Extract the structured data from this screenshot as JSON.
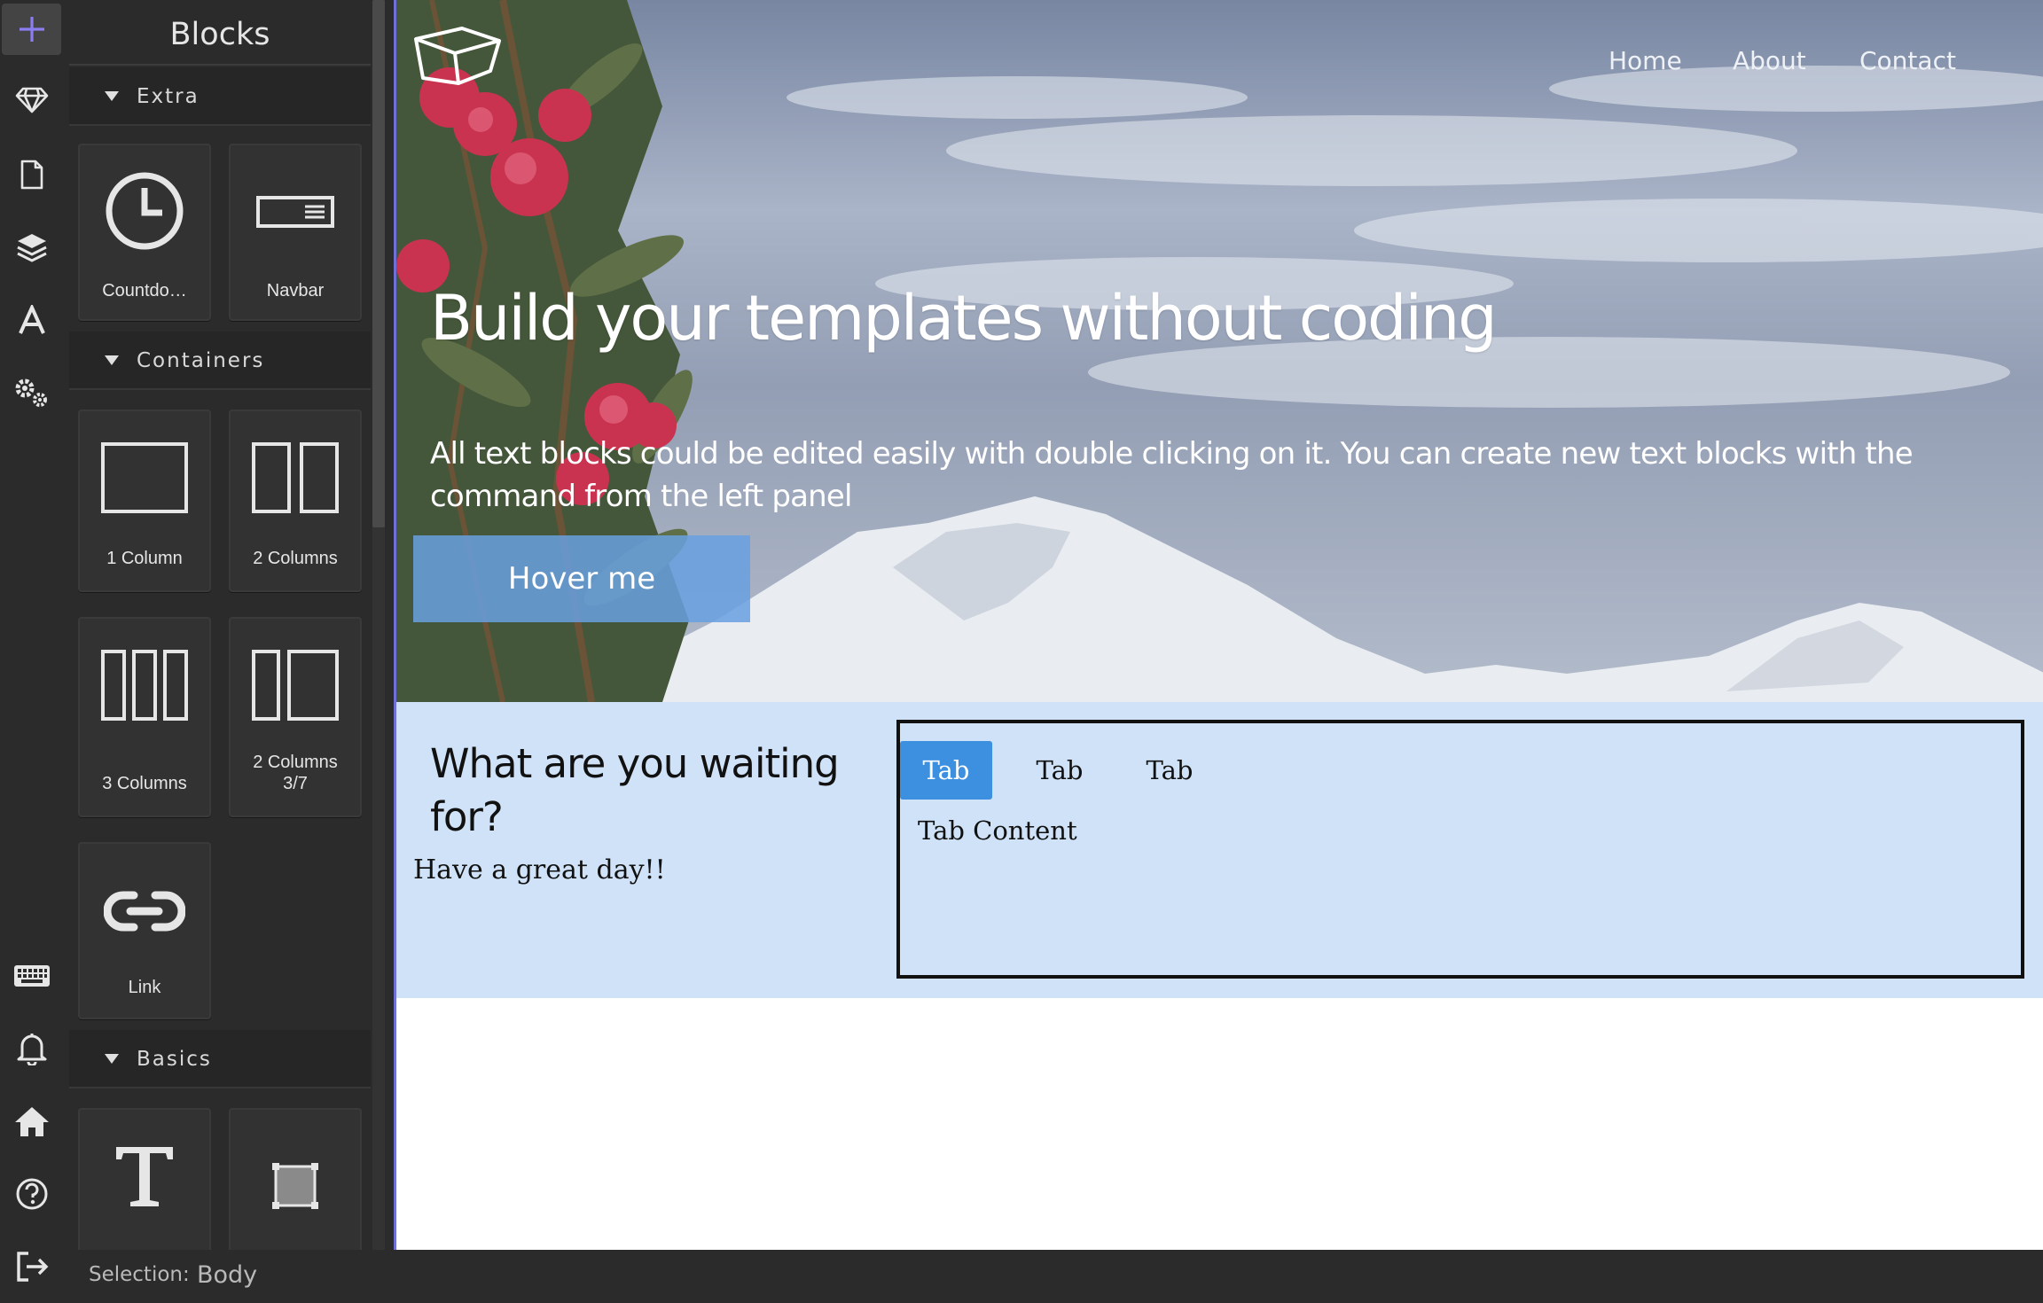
{
  "rail": {
    "top_icons": [
      "plus-icon",
      "diamond-icon",
      "page-icon",
      "layers-icon",
      "typography-icon",
      "settings-icon"
    ],
    "bottom_icons": [
      "keyboard-icon",
      "bell-icon",
      "home-icon",
      "help-icon",
      "logout-icon"
    ],
    "accent_color": "#8b7ef0"
  },
  "panel": {
    "title": "Blocks",
    "categories": [
      {
        "label": "Extra",
        "blocks": [
          {
            "label": "Countdo…",
            "icon": "clock-icon"
          },
          {
            "label": "Navbar",
            "icon": "navbar-icon"
          }
        ]
      },
      {
        "label": "Containers",
        "blocks": [
          {
            "label": "1 Column",
            "icon": "one-column-icon"
          },
          {
            "label": "2 Columns",
            "icon": "two-columns-icon"
          },
          {
            "label": "3 Columns",
            "icon": "three-columns-icon"
          },
          {
            "label": "2 Columns 3/7",
            "label_line1": "2 Columns",
            "label_line2": "3/7",
            "icon": "two-columns-3-7-icon"
          },
          {
            "label": "Link",
            "icon": "link-icon"
          }
        ]
      },
      {
        "label": "Basics",
        "blocks": [
          {
            "label": "",
            "icon": "text-icon"
          },
          {
            "label": "",
            "icon": "image-icon"
          }
        ]
      }
    ]
  },
  "canvas": {
    "nav": {
      "home": "Home",
      "about": "About",
      "contact": "Contact"
    },
    "hero": {
      "title": "Build your templates without coding",
      "lead": "All text blocks could be edited easily with double clicking on it. You can create new text blocks with the command from the left panel",
      "button": "Hover me"
    },
    "section": {
      "title": "What are you waiting for?",
      "text": "Have a great day!!",
      "tabs": [
        "Tab",
        "Tab",
        "Tab"
      ],
      "active_tab": 0,
      "tab_content": "Tab Content"
    }
  },
  "status": {
    "label": "Selection:",
    "value": "Body"
  },
  "colors": {
    "tab_active": "#3d8fe0",
    "section_bg": "#cfe2f7",
    "ui_dark": "#2b2b2b"
  }
}
